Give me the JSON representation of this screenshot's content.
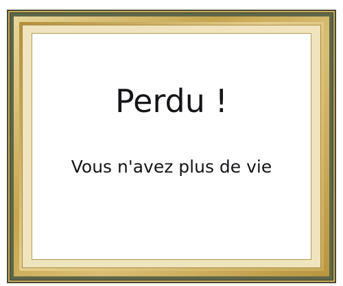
{
  "dialog": {
    "title": "Perdu !",
    "message": "Vous n'avez plus de vie"
  },
  "colors": {
    "frame_gold": "#c9ad5e",
    "frame_dark": "#5e6648",
    "text": "#141419",
    "background": "#ffffff"
  }
}
